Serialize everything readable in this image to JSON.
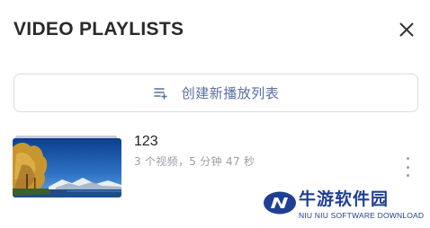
{
  "panel": {
    "title": "VIDEO PLAYLISTS",
    "close_icon": "close-icon"
  },
  "create_button": {
    "icon": "playlist-add-icon",
    "label": "创建新播放列表"
  },
  "playlists": [
    {
      "title": "123",
      "meta": "3 个视频，5 分钟 47 秒",
      "thumbnail_icon": "lake-landscape-thumbnail",
      "menu_icon": "more-vertical-icon"
    }
  ],
  "watermark": {
    "name": "牛游软件园",
    "subtitle": "NIU NIU SOFTWARE DOWNLOAD",
    "color": "#1f3f93"
  },
  "colors": {
    "title": "#2a2a2a",
    "accent": "#5b6fa0",
    "meta": "#9a9ea6",
    "border": "#d9dde3"
  }
}
